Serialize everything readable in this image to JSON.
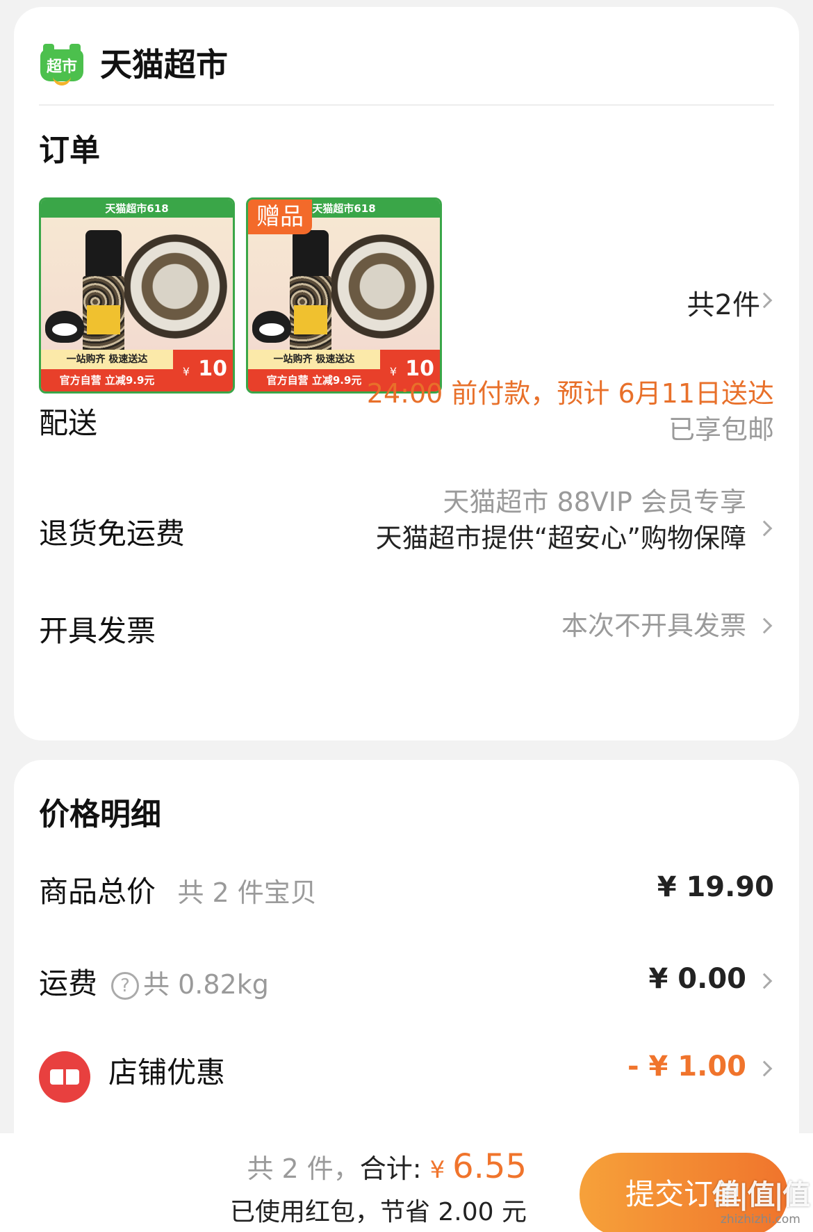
{
  "store": {
    "logo_text": "超市",
    "name": "天猫超市"
  },
  "order": {
    "title": "订单",
    "items": [
      {
        "banner": "天猫超市618",
        "badge": "",
        "promo_top": "一站购齐 极速送达",
        "promo_bottom": "官方自营 立减9.9元",
        "price": "10"
      },
      {
        "banner": "天猫超市618",
        "badge": "赠品",
        "promo_top": "一站购齐 极速送达",
        "promo_bottom": "官方自营 立减9.9元",
        "price": "10"
      }
    ],
    "count_label": "共2件"
  },
  "delivery": {
    "label": "配送",
    "eta": "24:00 前付款，预计 6月11日送达",
    "shipping": "已享包邮"
  },
  "returns": {
    "label": "退货免运费",
    "line1": "天猫超市 88VIP 会员专享",
    "line2": "天猫超市提供“超安心”购物保障"
  },
  "invoice": {
    "label": "开具发票",
    "value": "本次不开具发票"
  },
  "price_detail": {
    "title": "价格明细",
    "goods_total_label": "商品总价",
    "goods_total_sub": "共 2 件宝贝",
    "goods_total_value": "¥ 19.90",
    "freight_label": "运费",
    "freight_sub": "共 0.82kg",
    "freight_value": "¥ 0.00",
    "store_discount_label": "店铺优惠",
    "store_discount_value": "- ¥ 1.00"
  },
  "footer": {
    "count": "共 2 件，",
    "total_label": "合计: ",
    "currency": "¥ ",
    "total": "6.55",
    "savings": "已使用红包，节省 2.00 元",
    "submit": "提交订单"
  },
  "watermark": {
    "text": "值|值|值",
    "url": "zhizhizhi.com"
  },
  "colors": {
    "accent": "#f0742c",
    "brand_green": "#4cc04d",
    "coupon_red": "#e8403f"
  }
}
